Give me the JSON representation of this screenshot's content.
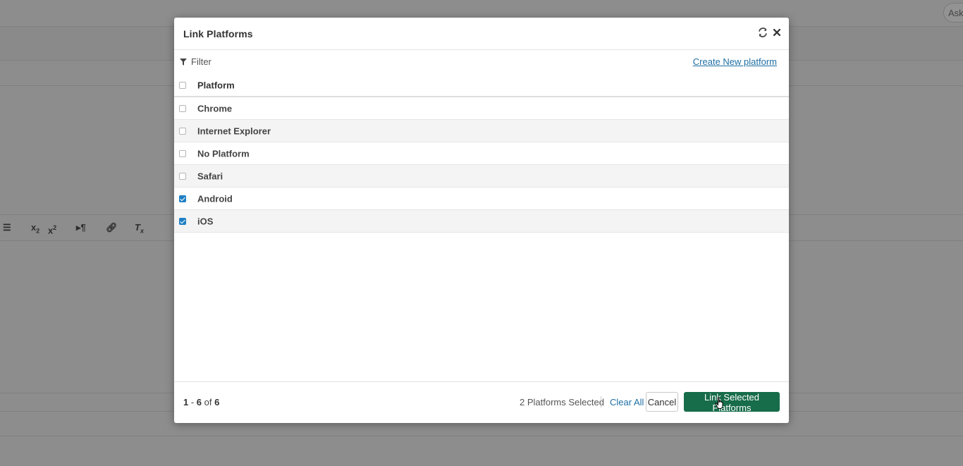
{
  "background": {
    "ask_button": "Ask"
  },
  "dialog": {
    "title": "Link Platforms",
    "filter_label": "Filter",
    "create_link": "Create New platform",
    "column_header": "Platform",
    "rows": [
      {
        "name": "Chrome",
        "checked": false
      },
      {
        "name": "Internet Explorer",
        "checked": false
      },
      {
        "name": "No Platform",
        "checked": false
      },
      {
        "name": "Safari",
        "checked": false
      },
      {
        "name": "Android",
        "checked": true
      },
      {
        "name": "iOS",
        "checked": true
      }
    ],
    "footer": {
      "range_start": "1",
      "range_end": "6",
      "of_label": "of",
      "total": "6",
      "selected_text": "2 Platforms Selected",
      "clear_all": "Clear All",
      "cancel": "Cancel",
      "link_selected": "Link Selected Platforms"
    }
  },
  "colors": {
    "primary_button": "#176c4a",
    "link": "#1f6fa3",
    "checkbox_checked": "#1f7fc4"
  }
}
